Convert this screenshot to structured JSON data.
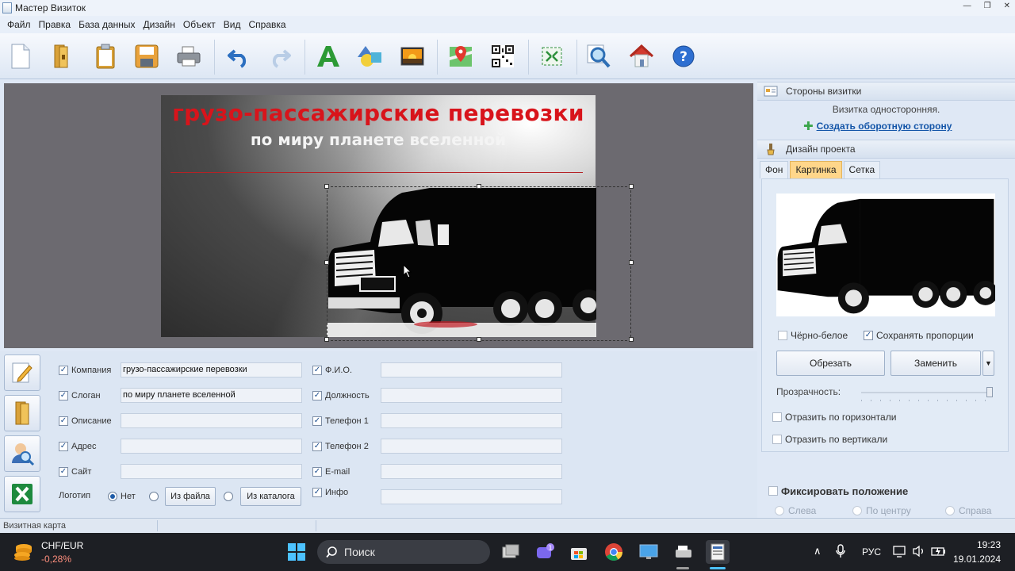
{
  "window": {
    "title": "Мастер Визиток"
  },
  "menu": [
    "Файл",
    "Правка",
    "База данных",
    "Дизайн",
    "Объект",
    "Вид",
    "Справка"
  ],
  "toolbar": {
    "icons": [
      "new-document-icon",
      "open-folder-icon",
      "clipboard-icon",
      "save-icon",
      "print-icon",
      "undo-icon",
      "redo-icon",
      "text-icon",
      "shapes-icon",
      "image-icon",
      "map-icon",
      "qr-code-icon",
      "fit-icon",
      "zoom-icon",
      "home-icon",
      "help-icon"
    ]
  },
  "card": {
    "company": "грузо-пассажирские перевозки",
    "slogan": "по миру планете вселенной",
    "colors": {
      "company": "#d8141b",
      "slogan": "#f4f4f4",
      "line": "#b52226"
    }
  },
  "form": {
    "company_label": "Компания",
    "company_value": "грузо-пассажирские перевозки",
    "slogan_label": "Слоган",
    "slogan_value": "по миру планете вселенной",
    "description_label": "Описание",
    "description_value": "",
    "address_label": "Адрес",
    "address_value": "",
    "site_label": "Сайт",
    "site_value": "",
    "logo_label": "Логотип",
    "logo_none": "Нет",
    "logo_file": "Из файла",
    "logo_catalog": "Из каталога",
    "fio_label": "Ф.И.О.",
    "position_label": "Должность",
    "phone1_label": "Телефон 1",
    "phone2_label": "Телефон 2",
    "email_label": "E-mail",
    "info_label": "Инфо"
  },
  "right_panel": {
    "sides_header": "Стороны визитки",
    "sides_text": "Визитка односторонняя.",
    "create_back_link": "Создать оборотную сторону",
    "design_header": "Дизайн проекта",
    "tabs": [
      "Фон",
      "Картинка",
      "Сетка"
    ],
    "active_tab": "Картинка",
    "bw_label": "Чёрно-белое",
    "keep_ratio_label": "Сохранять пропорции",
    "crop_button": "Обрезать",
    "replace_button": "Заменить",
    "transparency_label": "Прозрачность:",
    "flip_h_label": "Отразить по горизонтали",
    "flip_v_label": "Отразить по вертикали",
    "fix_position_label": "Фиксировать положение",
    "align_left": "Слева",
    "align_center": "По центру",
    "align_right": "Справа"
  },
  "status": {
    "text": "Визитная карта"
  },
  "taskbar": {
    "currency_pair": "CHF/EUR",
    "currency_change": "-0,28%",
    "search_placeholder": "Поиск",
    "language": "РУС",
    "time": "19:23",
    "date": "19.01.2024",
    "chat_badge": "1"
  }
}
